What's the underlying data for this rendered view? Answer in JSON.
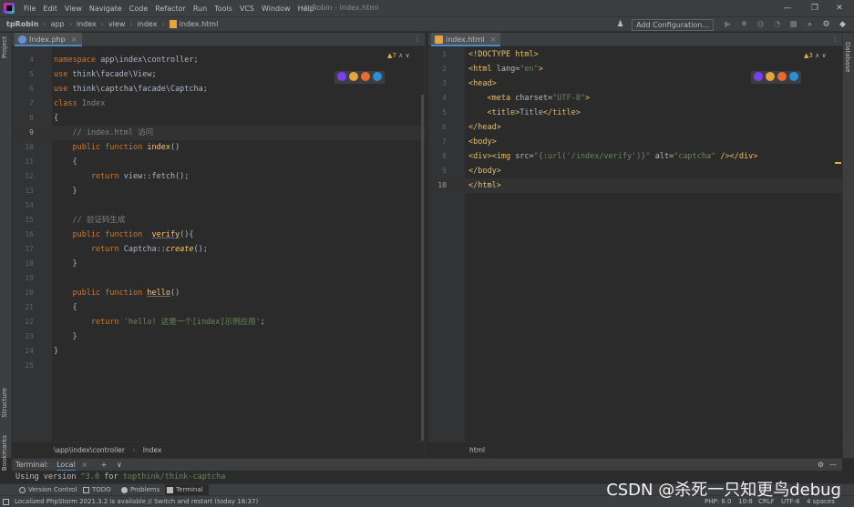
{
  "window": {
    "title": "tpRobin - index.html",
    "menu": [
      "File",
      "Edit",
      "View",
      "Navigate",
      "Code",
      "Refactor",
      "Run",
      "Tools",
      "VCS",
      "Window",
      "Help"
    ]
  },
  "navbar": {
    "crumbs": [
      "tpRobin",
      "app",
      "index",
      "view",
      "index",
      "index.html"
    ],
    "add_config_label": "Add Configuration..."
  },
  "left_stripe": {
    "project": "Project",
    "structure": "Structure",
    "bookmarks": "Bookmarks"
  },
  "right_stripe": {
    "database": "Database"
  },
  "left_editor": {
    "tab_label": "Index.php",
    "inspect_count": "7",
    "footer_path": "\\app\\index\\controller",
    "footer_class": "Index",
    "lines": [
      {
        "n": "4",
        "segs": [
          [
            "kw",
            "namespace "
          ],
          [
            "cls",
            "app\\index\\controller;"
          ]
        ]
      },
      {
        "n": "5",
        "segs": [
          [
            "kw",
            "use "
          ],
          [
            "cls",
            "think\\facade\\View;"
          ]
        ]
      },
      {
        "n": "6",
        "segs": [
          [
            "kw",
            "use "
          ],
          [
            "cls",
            "think\\captcha\\facade\\Captcha;"
          ]
        ]
      },
      {
        "n": "7",
        "segs": [
          [
            "kw",
            "class "
          ],
          [
            "cmt",
            "Index"
          ]
        ]
      },
      {
        "n": "8",
        "segs": [
          [
            "cls",
            "{"
          ]
        ]
      },
      {
        "n": "9",
        "segs": [
          [
            "cmt",
            "    // index.html 访问"
          ]
        ]
      },
      {
        "n": "10",
        "segs": [
          [
            "kw",
            "    public function "
          ],
          [
            "fn",
            "index"
          ],
          [
            "cls",
            "()"
          ]
        ]
      },
      {
        "n": "11",
        "segs": [
          [
            "cls",
            "    {"
          ]
        ]
      },
      {
        "n": "12",
        "segs": [
          [
            "kw",
            "        return "
          ],
          [
            "cls",
            "view::fetch();"
          ]
        ]
      },
      {
        "n": "13",
        "segs": [
          [
            "cls",
            "    }"
          ]
        ]
      },
      {
        "n": "14",
        "segs": [
          [
            "cls",
            ""
          ]
        ]
      },
      {
        "n": "15",
        "segs": [
          [
            "cmt",
            "    // 验证码生成"
          ]
        ]
      },
      {
        "n": "16",
        "segs": [
          [
            "kw",
            "    public function  "
          ],
          [
            "fnu",
            "verify"
          ],
          [
            "cls",
            "(){"
          ]
        ]
      },
      {
        "n": "17",
        "segs": [
          [
            "kw",
            "        return "
          ],
          [
            "cls",
            "Captcha::"
          ],
          [
            "fni",
            "create"
          ],
          [
            "cls",
            "();"
          ]
        ]
      },
      {
        "n": "18",
        "segs": [
          [
            "cls",
            "    }"
          ]
        ]
      },
      {
        "n": "19",
        "segs": [
          [
            "cls",
            ""
          ]
        ]
      },
      {
        "n": "20",
        "segs": [
          [
            "kw",
            "    public function "
          ],
          [
            "fnu",
            "hello"
          ],
          [
            "cls",
            "()"
          ]
        ]
      },
      {
        "n": "21",
        "segs": [
          [
            "cls",
            "    {"
          ]
        ]
      },
      {
        "n": "22",
        "segs": [
          [
            "kw",
            "        return "
          ],
          [
            "str",
            "'hello! 这是一个[index]示例应用'"
          ],
          [
            "cls",
            ";"
          ]
        ]
      },
      {
        "n": "23",
        "segs": [
          [
            "cls",
            "    }"
          ]
        ]
      },
      {
        "n": "24",
        "segs": [
          [
            "cls",
            "}"
          ]
        ]
      },
      {
        "n": "25",
        "segs": [
          [
            "cls",
            ""
          ]
        ]
      }
    ]
  },
  "right_editor": {
    "tab_label": "index.html",
    "inspect_count": "3",
    "footer_path": "html",
    "lines": [
      {
        "n": "1",
        "segs": [
          [
            "tag",
            "<!DOCTYPE html>"
          ]
        ]
      },
      {
        "n": "2",
        "segs": [
          [
            "tag",
            "<html "
          ],
          [
            "attr",
            "lang="
          ],
          [
            "str",
            "\"en\""
          ],
          [
            "tag",
            ">"
          ]
        ]
      },
      {
        "n": "3",
        "segs": [
          [
            "tag",
            "<head>"
          ]
        ]
      },
      {
        "n": "4",
        "segs": [
          [
            "tag",
            "    <meta "
          ],
          [
            "attr",
            "charset="
          ],
          [
            "str",
            "\"UTF-8\""
          ],
          [
            "tag",
            ">"
          ]
        ]
      },
      {
        "n": "5",
        "segs": [
          [
            "tag",
            "    <title>"
          ],
          [
            "cls",
            "Title"
          ],
          [
            "tag",
            "</title>"
          ]
        ]
      },
      {
        "n": "6",
        "segs": [
          [
            "tag",
            "</head>"
          ]
        ]
      },
      {
        "n": "7",
        "segs": [
          [
            "tag",
            "<body>"
          ]
        ]
      },
      {
        "n": "8",
        "segs": [
          [
            "tag",
            "<div><img "
          ],
          [
            "attr",
            "src="
          ],
          [
            "str",
            "\"{:url('/index/verify')}\""
          ],
          [
            "attr",
            " alt="
          ],
          [
            "str",
            "\"captcha\""
          ],
          [
            "tag",
            " /></div>"
          ]
        ]
      },
      {
        "n": "9",
        "segs": [
          [
            "tag",
            "</body>"
          ]
        ]
      },
      {
        "n": "10",
        "segs": [
          [
            "tag",
            "</html>"
          ]
        ]
      }
    ]
  },
  "terminal": {
    "label": "Terminal:",
    "tab": "Local",
    "output_prefix": "Using version ",
    "output_version": "^3.0",
    "output_for": " for ",
    "output_pkg": "topthink/think-captcha"
  },
  "bottom_tabs": [
    "Version Control",
    "TODO",
    "Problems",
    "Terminal"
  ],
  "status": {
    "message": "Localized PhpStorm 2021.3.2 is available // Switch and restart (today 16:37)",
    "php": "PHP: 8.0",
    "pos": "10:8",
    "le": "CRLF",
    "enc": "UTF-8",
    "indent": "4 spaces"
  },
  "watermark": "CSDN @杀死一只知更鸟debug",
  "colors": {
    "accent": "#4a88c7",
    "keyword": "#cc7832",
    "function": "#ffc66d",
    "string": "#6a8759",
    "tag": "#e8bf6a"
  }
}
